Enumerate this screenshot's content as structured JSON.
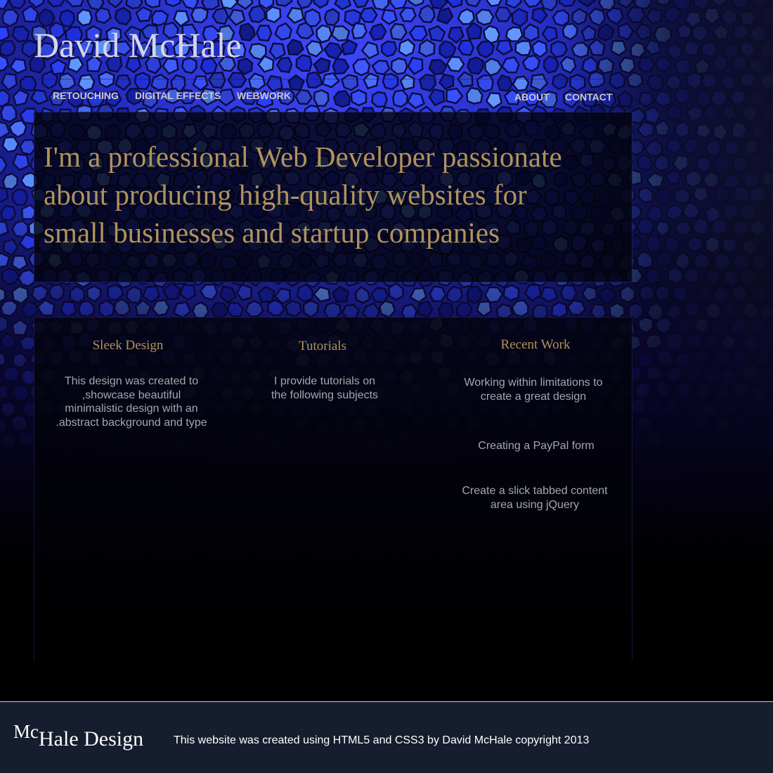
{
  "header": {
    "site_title": "David McHale"
  },
  "nav": {
    "left": [
      "RETOUCHING",
      "DIGITAL EFFECTS",
      "WEBWORK"
    ],
    "right": [
      "ABOUT",
      "CONTACT"
    ]
  },
  "hero": {
    "text": " I'm a professional Web Developer passionate\nabout producing high-quality websites for\nsmall businesses and startup companies"
  },
  "columns": [
    {
      "heading": "Sleek Design",
      "paragraphs": [
        "This design was created to\n,showcase beautiful\nminimalistic design with an\n.abstract background and type"
      ]
    },
    {
      "heading": "Tutorials",
      "paragraphs": [
        "I provide tutorials on\nthe following subjects"
      ]
    },
    {
      "heading": "Recent Work",
      "paragraphs": [
        "Working within limitations to\ncreate a great design",
        "Creating a PayPal form",
        "Create a slick tabbed content\narea using jQuery"
      ]
    }
  ],
  "footer": {
    "logo_mc": "Mc",
    "logo_rest": "Hale Design",
    "credit": "This website was created using HTML5 and CSS3 by David McHale copyright 2013"
  },
  "colors": {
    "mosaic_blue": "#2a3fe0",
    "grout": "#0c0c3c",
    "gold_text": "#b0935c",
    "nav_text": "#c9c9cf",
    "body_text": "#a6a6ad",
    "footer_bg": "#161d2e"
  }
}
